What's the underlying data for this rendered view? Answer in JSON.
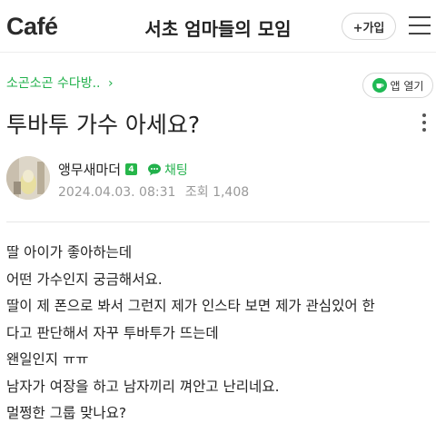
{
  "header": {
    "logo": "Café",
    "cafe_name": "서초 엄마들의 모임",
    "join_label": "+가입"
  },
  "board": {
    "name": "소곤소곤 수다방..",
    "chevron": "›",
    "app_open_label": "앱 열기"
  },
  "post": {
    "title": "투바투 가수 아세요?",
    "author": "앵무새마더",
    "level": "4",
    "chat_label": "채팅",
    "date": "2024.04.03. 08:31",
    "views_label": "조회 1,408",
    "lines": [
      "딸 아이가 좋아하는데",
      "어떤 가수인지 궁금해서요.",
      "딸이 제 폰으로 봐서 그런지 제가 인스타 보면 제가 관심있어 한",
      "다고 판단해서 자꾸 투바투가 뜨는데",
      "왠일인지 ㅠㅠ",
      "남자가 여장을 하고 남자끼리 껴안고 난리네요.",
      "멀쩡한 그룹 맞나요?"
    ]
  },
  "icons": {
    "menu": "hamburger-icon",
    "more": "more-vertical-icon",
    "app": "cafe-cup-icon",
    "chat": "chat-bubble-icon"
  },
  "colors": {
    "accent_green": "#22b14c",
    "text": "#222222",
    "meta_gray": "#999999"
  }
}
